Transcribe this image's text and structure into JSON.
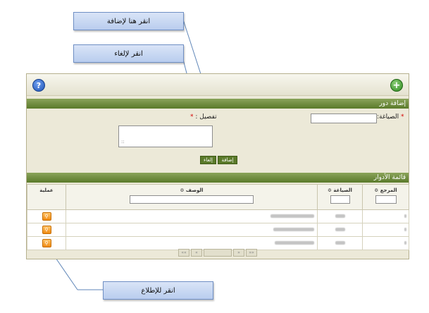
{
  "callouts": {
    "add": "انقر هنا لإضافة",
    "cancel": "انقر لإلغاء",
    "view": "انقر للإطلاع"
  },
  "toolbar": {
    "help_glyph": "?",
    "add_glyph": "+"
  },
  "add_section": {
    "title": "إضافة دور",
    "formulation_label": "الصياغة:",
    "details_label": "تفصيل :",
    "required_mark": "*",
    "add_button": "إضافة",
    "cancel_button": "إلغاء",
    "textarea_value": "::"
  },
  "list_section": {
    "title": "قائمة الأدوار",
    "columns": {
      "reference": "المرجع ≎",
      "formulation": "الصياغة ≎",
      "description": "الوصف ≎",
      "action": "عملية"
    },
    "row_count": 3
  },
  "pager": {
    "first": "««",
    "prev": "«",
    "next": "»",
    "last": "»»"
  },
  "colors": {
    "header_green": "#5a7a2a",
    "panel_bg": "#ece9d8",
    "callout_bg": "#c7d6f2"
  }
}
